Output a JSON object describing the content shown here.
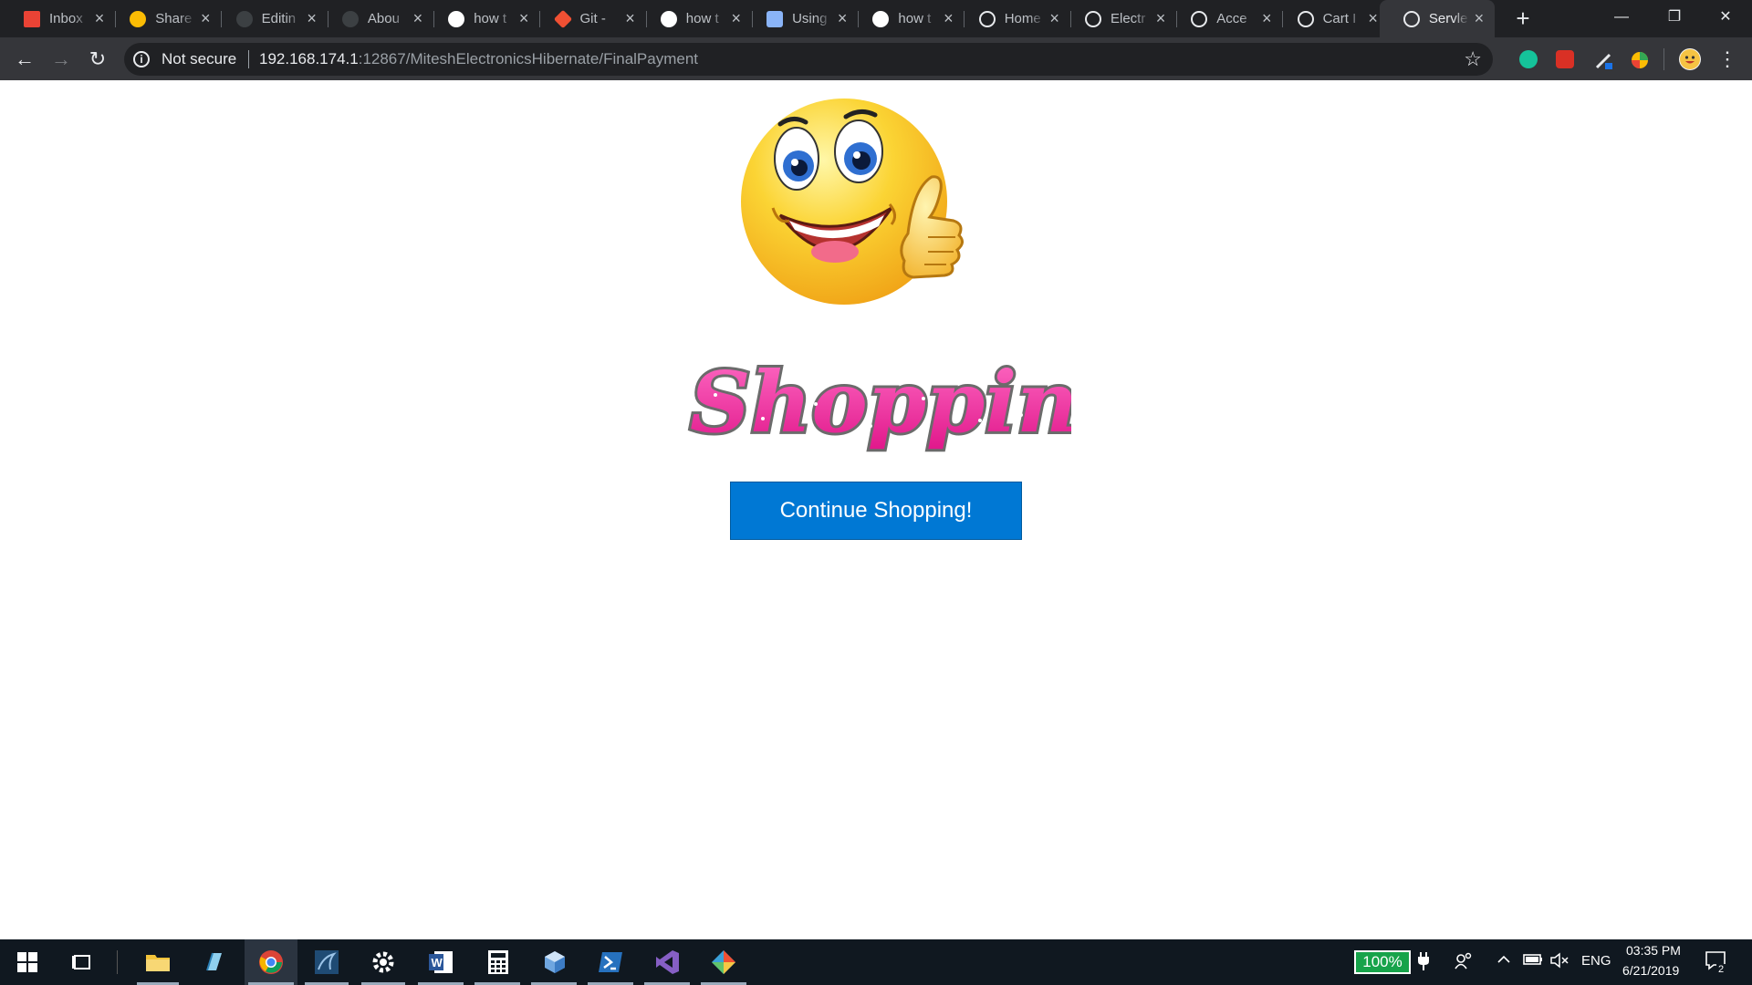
{
  "browser": {
    "tabs": [
      {
        "label": "Inbox",
        "icon": "gmail-icon",
        "color": "#ea4335"
      },
      {
        "label": "Share",
        "icon": "google-drive-icon",
        "color": "#fbbc04"
      },
      {
        "label": "Editin",
        "icon": "github-icon",
        "color": "#3c4043"
      },
      {
        "label": "Abou",
        "icon": "github-icon",
        "color": "#3c4043"
      },
      {
        "label": "how t",
        "icon": "google-icon",
        "color": "#ffffff"
      },
      {
        "label": "Git - ",
        "icon": "git-icon",
        "color": "#f05033"
      },
      {
        "label": "how t",
        "icon": "google-icon",
        "color": "#ffffff"
      },
      {
        "label": "Using",
        "icon": "box-icon",
        "color": "#8ab4f8"
      },
      {
        "label": "how t",
        "icon": "google-icon",
        "color": "#ffffff"
      },
      {
        "label": "Home",
        "icon": "globe-icon",
        "color": "#e8eaed"
      },
      {
        "label": "Electr",
        "icon": "globe-icon",
        "color": "#e8eaed"
      },
      {
        "label": "Acce",
        "icon": "globe-icon",
        "color": "#e8eaed"
      },
      {
        "label": "Cart I",
        "icon": "globe-icon",
        "color": "#e8eaed"
      },
      {
        "label": "Servle",
        "icon": "globe-icon",
        "color": "#e8eaed",
        "active": true
      }
    ],
    "new_tab": "+",
    "window_controls": {
      "minimize": "—",
      "restore": "❐",
      "close": "✕"
    },
    "omnibox": {
      "security_label": "Not secure",
      "url_host": "192.168.174.1",
      "url_rest": ":12867/MiteshElectronicsHibernate/FinalPayment"
    }
  },
  "page": {
    "logo_text": "Shopping!",
    "continue_button": "Continue Shopping!"
  },
  "taskbar": {
    "apps": [
      "start-icon",
      "task-view-icon",
      "file-explorer-icon",
      "notepad-icon",
      "chrome-icon",
      "mysql-workbench-icon",
      "settings-icon",
      "word-icon",
      "calculator-icon",
      "box-icon",
      "powershell-icon",
      "visual-studio-icon",
      "git-icon"
    ],
    "battery_percent": "100%",
    "language": "ENG",
    "time": "03:35 PM",
    "date": "6/21/2019",
    "notification_count": "2"
  },
  "colors": {
    "chrome_dark": "#202124",
    "chrome_toolbar": "#35363a",
    "button_blue": "#0078d4",
    "shopping_pink": "#ff2da8"
  }
}
